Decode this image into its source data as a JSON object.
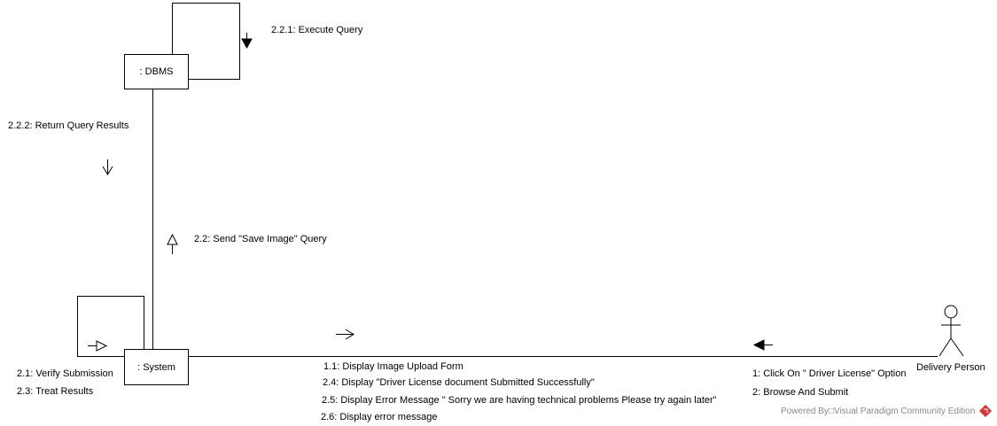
{
  "lifelines": {
    "dbms": ": DBMS",
    "system": ": System",
    "actor": "Delivery Person"
  },
  "messages": {
    "m221": "2.2.1: Execute Query",
    "m222": "2.2.2: Return Query Results",
    "m22": "2.2: Send \"Save Image\" Query",
    "m21": "2.1: Verify Submission",
    "m23": "2.3: Treat Results",
    "m11": "1.1: Display Image Upload Form",
    "m24": "2.4: Display \"Driver License document Submitted Successfully\"",
    "m25": "2.5: Display Error Message \" Sorry we are having technical problems Please try again later\"",
    "m26": "2.6: Display error message",
    "m1": "1: Click On \" Driver License\" Option",
    "m2": "2: Browse And Submit"
  },
  "watermark": "Powered By□Visual Paradigm Community Edition",
  "colors": {
    "logo": "#d9343a",
    "watermark": "#888888"
  }
}
